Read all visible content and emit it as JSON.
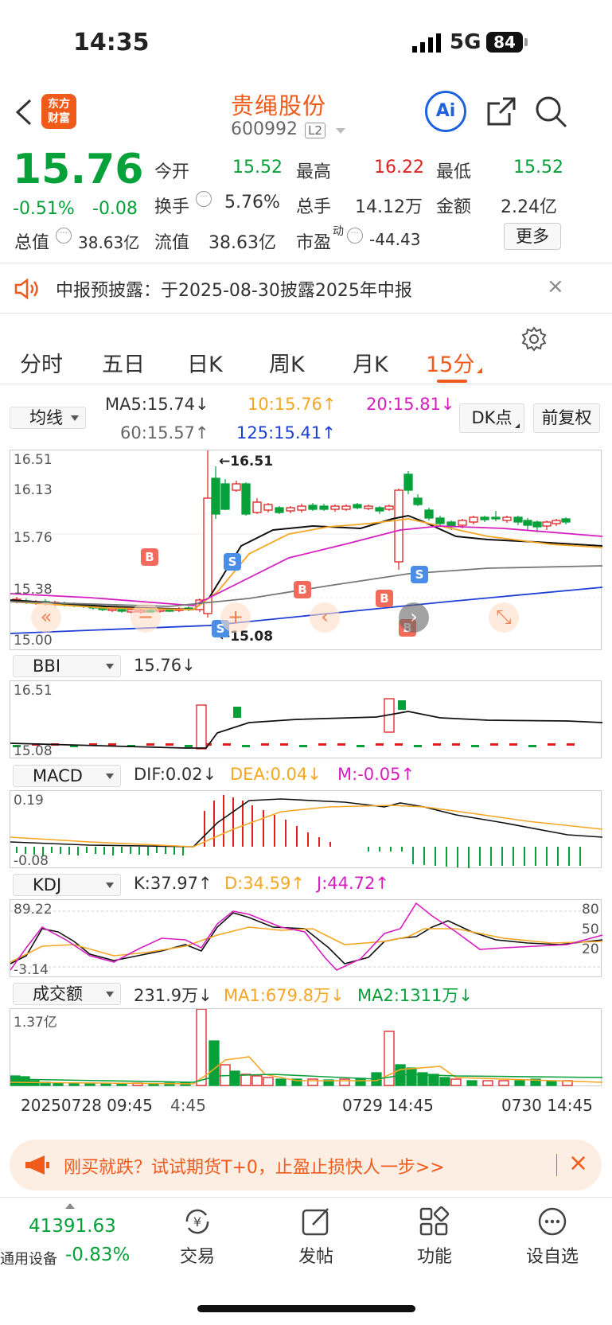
{
  "status": {
    "time": "14:35",
    "network": "5G",
    "battery": "84"
  },
  "nav": {
    "title": "贵绳股份",
    "code": "600992",
    "level": "L2",
    "logo_line1": "东方",
    "logo_line2": "财富",
    "ai_label": "Ai"
  },
  "quote": {
    "price": "15.76",
    "change_pct": "-0.51%",
    "change": "-0.08",
    "open_label": "今开",
    "open": "15.52",
    "high_label": "最高",
    "high": "16.22",
    "low_label": "最低",
    "low": "15.52",
    "turnover_label": "换手",
    "turnover": "5.76%",
    "volume_label": "总手",
    "volume": "14.12万",
    "amount_label": "金额",
    "amount": "2.24亿",
    "mktcap_label": "总值",
    "mktcap": "38.63亿",
    "float_label": "流值",
    "float": "38.63亿",
    "pe_label": "市盈",
    "pe_sup": "动",
    "pe": "-44.43",
    "more_label": "更多"
  },
  "notice": {
    "text": "中报预披露：于2025-08-30披露2025年中报"
  },
  "tabs": [
    "分时",
    "五日",
    "日K",
    "周K",
    "月K",
    "15分"
  ],
  "active_tab": "15分",
  "ma": {
    "select": "均线",
    "ma5": "MA5:15.74",
    "ma10": "10:15.76",
    "ma20": "20:15.81",
    "ma60": "60:15.57",
    "ma125": "125:15.41",
    "dk": "DK点",
    "fq": "前复权",
    "ma5_arrow": "↓",
    "ma10_arrow": "↑",
    "ma20_arrow": "↓",
    "ma60_arrow": "↑",
    "ma125_arrow": "↑"
  },
  "kline": {
    "y_labels": [
      "16.51",
      "16.13",
      "15.76",
      "15.38",
      "15.00"
    ],
    "high_marker": "16.51",
    "low_marker": "15.08"
  },
  "bbi": {
    "select": "BBI",
    "value": "15.76",
    "arrow": "↓",
    "y_top": "16.51",
    "y_bottom": "15.08"
  },
  "macd": {
    "select": "MACD",
    "dif": "DIF:0.02",
    "dea": "DEA:0.04",
    "m": "M:-0.05",
    "dif_arrow": "↓",
    "dea_arrow": "↓",
    "m_arrow": "↑",
    "y_top": "0.19",
    "y_bottom": "-0.08"
  },
  "kdj": {
    "select": "KDJ",
    "k": "K:37.97",
    "d": "D:34.59",
    "j": "J:44.72",
    "k_arrow": "↑",
    "d_arrow": "↑",
    "j_arrow": "↑",
    "y_top": "89.22",
    "y_bottom": "-3.14",
    "r80": "80",
    "r50": "50",
    "r20": "20"
  },
  "amount": {
    "select": "成交额",
    "value": "231.9万",
    "ma1": "MA1:679.8万",
    "ma2": "MA2:1311万",
    "arrow": "↓",
    "ma1_arrow": "↓",
    "ma2_arrow": "↓",
    "y_top": "1.37亿"
  },
  "x_axis": {
    "left": "20250728 09:45",
    "mid_a": "4:45",
    "mid": "0729 14:45",
    "right": "0730 14:45"
  },
  "banner": {
    "text": "刚买就跌？试试期货T+0，止盈止损快人一步>>"
  },
  "bottom": {
    "index_value": "41391.63",
    "index_name": "通用设备",
    "index_change": "-0.83%",
    "trade": "交易",
    "post": "发帖",
    "func": "功能",
    "watch": "设自选"
  },
  "signals": {
    "buy": "B",
    "sell": "S"
  },
  "colors": {
    "up": "#e02020",
    "down": "#07a13a",
    "accent": "#f05a1a"
  }
}
